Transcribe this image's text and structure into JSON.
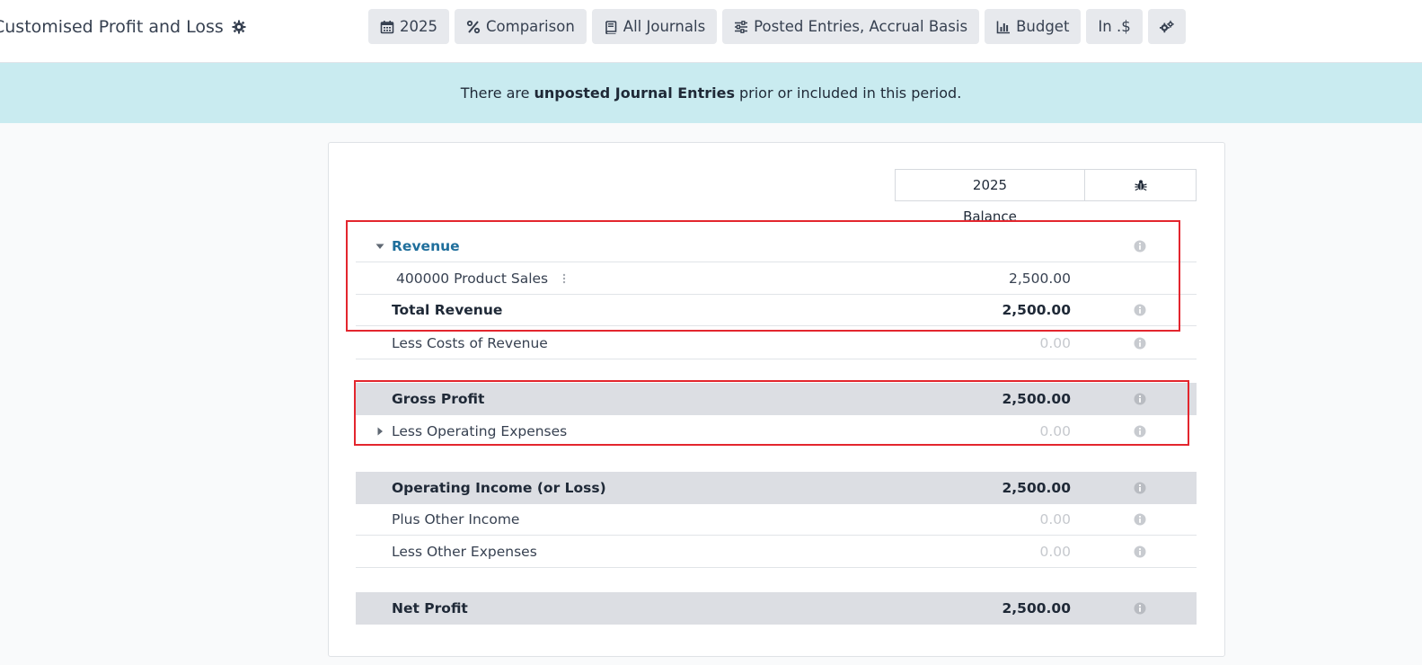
{
  "header": {
    "title": "Customised Profit and Loss",
    "toolbar": {
      "period": "2025",
      "comparison": "Comparison",
      "journals": "All Journals",
      "entries": "Posted Entries, Accrual Basis",
      "budget": "Budget",
      "currency": "In .$"
    }
  },
  "banner": {
    "prefix": "There are",
    "strong": "unposted Journal Entries",
    "suffix": "prior or included in this period."
  },
  "report": {
    "column_year": "2025",
    "column_subheader": "Balance",
    "rows": [
      {
        "label": "Revenue",
        "value": ""
      },
      {
        "label": "400000 Product Sales",
        "value": "2,500.00"
      },
      {
        "label": "Total Revenue",
        "value": "2,500.00"
      },
      {
        "label": "Less Costs of Revenue",
        "value": "0.00"
      },
      {
        "label": "Gross Profit",
        "value": "2,500.00"
      },
      {
        "label": "Less Operating Expenses",
        "value": "0.00"
      },
      {
        "label": "Operating Income (or Loss)",
        "value": "2,500.00"
      },
      {
        "label": "Plus Other Income",
        "value": "0.00"
      },
      {
        "label": "Less Other Expenses",
        "value": "0.00"
      },
      {
        "label": "Net Profit",
        "value": "2,500.00"
      }
    ]
  },
  "colors": {
    "highlight": "#e3262e",
    "banner": "#c9ebf0",
    "section_link": "#1f6f9c",
    "shaded_row": "#dcdee3"
  }
}
